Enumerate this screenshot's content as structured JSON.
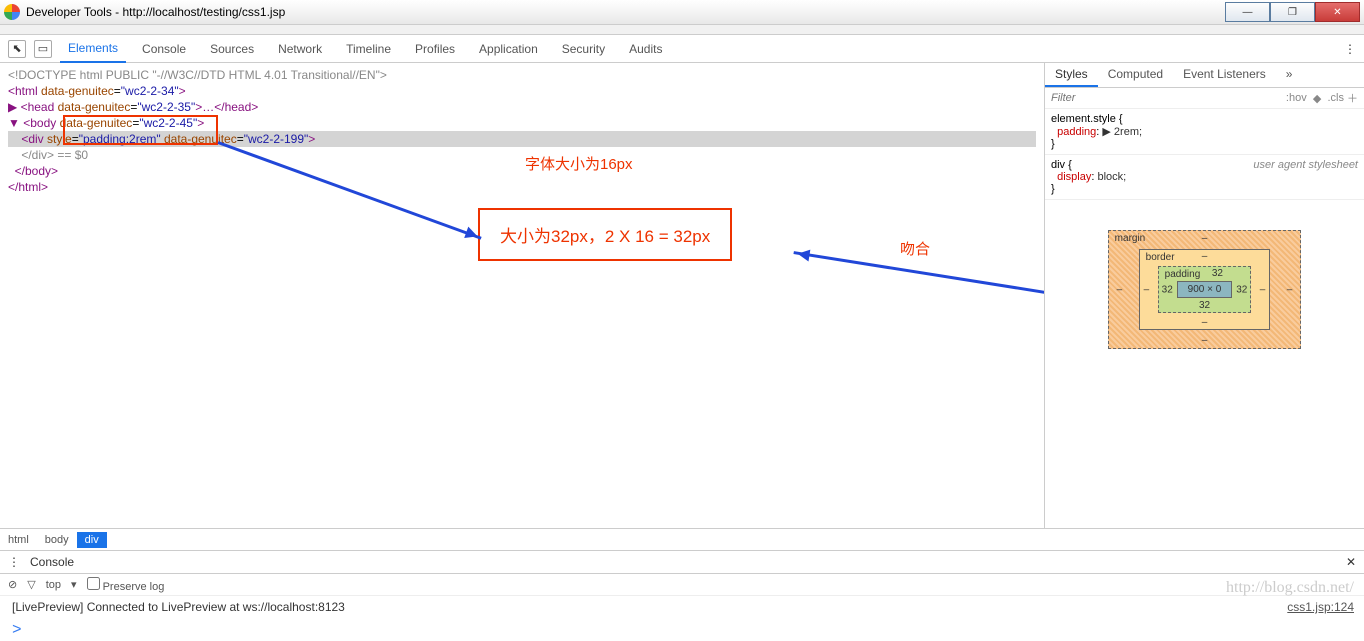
{
  "titlebar": {
    "title": "Developer Tools - http://localhost/testing/css1.jsp"
  },
  "toolbar": {
    "tabs": [
      "Elements",
      "Console",
      "Sources",
      "Network",
      "Timeline",
      "Profiles",
      "Application",
      "Security",
      "Audits"
    ],
    "active": 0
  },
  "dom": {
    "l1": "<!DOCTYPE html PUBLIC \"-//W3C//DTD HTML 4.01 Transitional//EN\">",
    "l2_open": "<html ",
    "l2_attr": "data-genuitec",
    "l2_val": "\"wc2-2-34\"",
    "l2_close": ">",
    "l3_a": "▶ <head ",
    "l3_attr": "data-genuitec",
    "l3_val": "\"wc2-2-35\"",
    "l3_b": ">…</head>",
    "l4_a": "▼ <body ",
    "l4_attr": "data-genuitec",
    "l4_val": "\"wc2-2-45\"",
    "l4_b": ">",
    "l5_a": "    <div ",
    "l5_attr1": "style",
    "l5_val1": "\"padding:2rem\"",
    "l5_attr2": "data-genuitec",
    "l5_val2": "\"wc2-2-199\"",
    "l5_b": ">",
    "l6": "    </div> == $0",
    "l7": "  </body>",
    "l8": "</html>"
  },
  "annotations": {
    "font_note": "字体大小为16px",
    "calc_note": "大小为32px，2 X 16 = 32px",
    "match_note": "吻合"
  },
  "styles": {
    "tabs": [
      "Styles",
      "Computed",
      "Event Listeners"
    ],
    "more": "»",
    "filter_ph": "Filter",
    "hov": ":hov",
    "cls": ".cls",
    "rule1_sel": "element.style {",
    "rule1_prop": "padding",
    "rule1_val": "▶ 2rem;",
    "rule1_end": "}",
    "rule2_sel": "div {",
    "rule2_uas": "user agent stylesheet",
    "rule2_prop": "display",
    "rule2_val": "block;",
    "rule2_end": "}"
  },
  "boxmodel": {
    "margin": "margin",
    "border": "border",
    "padding": "padding",
    "pad_val": "32",
    "content": "900 × 0",
    "dash": "–"
  },
  "breadcrumb": {
    "items": [
      "html",
      "body",
      "div"
    ],
    "active": 2
  },
  "console": {
    "title": "Console",
    "top": "top",
    "preserve": "Preserve log",
    "msg": "[LivePreview] Connected to LivePreview at ws://localhost:8123",
    "link": "css1.jsp:124",
    "prompt": ">"
  },
  "watermark": "http://blog.csdn.net/"
}
